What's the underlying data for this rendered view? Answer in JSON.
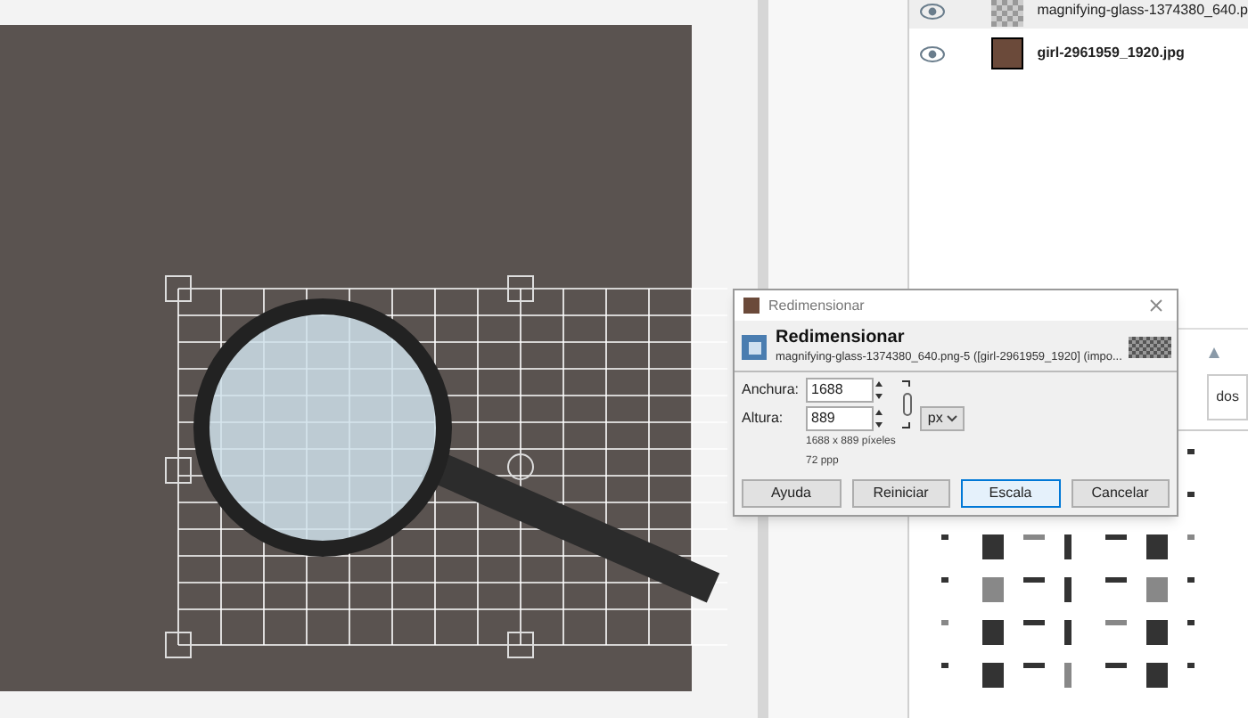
{
  "layers": [
    {
      "name": "magnifying-glass-1374380_640.p",
      "visible": true,
      "selected": true,
      "kind": "transparent"
    },
    {
      "name": "girl-2961959_1920.jpg",
      "visible": true,
      "selected": false,
      "kind": "photo"
    }
  ],
  "panel_tab": "dos",
  "dialog": {
    "title": "Redimensionar",
    "heading": "Redimensionar",
    "subtitle": "magnifying-glass-1374380_640.png-5 ([girl-2961959_1920] (impo...",
    "fields": [
      {
        "label": "Anchura:",
        "value": "1688"
      },
      {
        "label": "Altura:",
        "value": "889"
      }
    ],
    "unit": "px",
    "size_info": "1688 x 889 píxeles",
    "resolution": "72 ppp",
    "buttons": [
      {
        "label": "Ayuda",
        "focused": false
      },
      {
        "label": "Reiniciar",
        "focused": false
      },
      {
        "label": "Escala",
        "focused": true
      },
      {
        "label": "Cancelar",
        "focused": false
      }
    ]
  }
}
